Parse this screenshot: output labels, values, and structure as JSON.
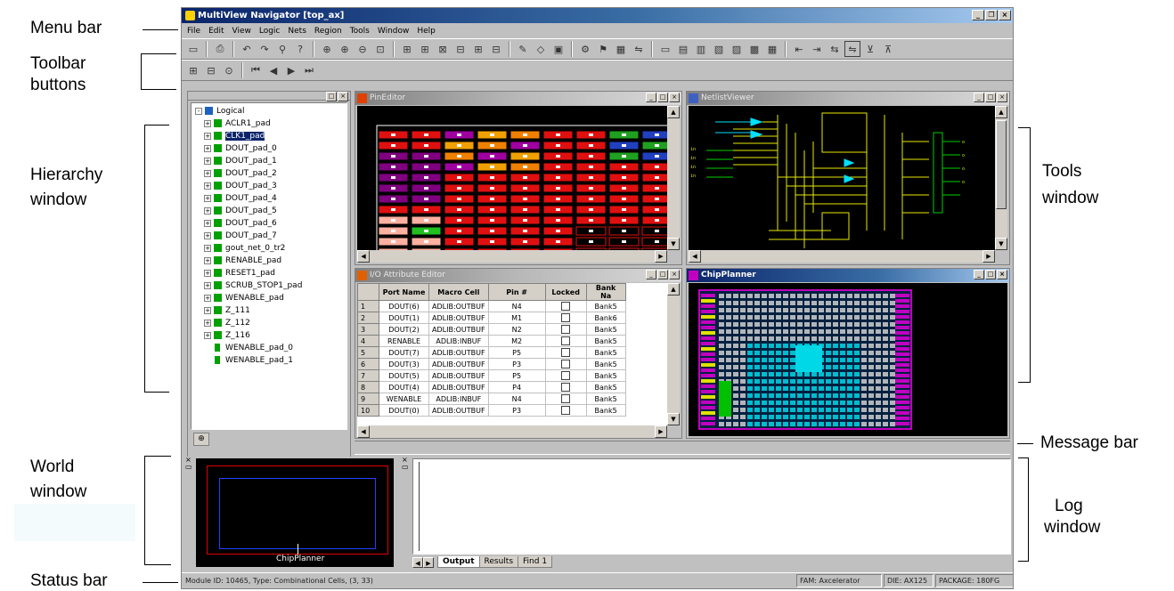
{
  "callouts": {
    "menu_bar": "Menu bar",
    "toolbar_buttons_1": "Toolbar",
    "toolbar_buttons_2": "buttons",
    "hierarchy_window_1": "Hierarchy",
    "hierarchy_window_2": "window",
    "tools_window_1": "Tools",
    "tools_window_2": "window",
    "message_bar": "Message bar",
    "world_window_1": "World",
    "world_window_2": "window",
    "log_window_1": "Log",
    "log_window_2": "window",
    "status_bar": "Status bar"
  },
  "app": {
    "title": "MultiView Navigator [top_ax]",
    "menu": [
      "File",
      "Edit",
      "View",
      "Logic",
      "Nets",
      "Region",
      "Tools",
      "Window",
      "Help"
    ]
  },
  "hierarchy": {
    "root": "Logical",
    "items": [
      {
        "label": "ACLR1_pad",
        "expand": "+",
        "selected": false
      },
      {
        "label": "CLK1_pad",
        "expand": "+",
        "selected": true
      },
      {
        "label": "DOUT_pad_0",
        "expand": "+",
        "selected": false
      },
      {
        "label": "DOUT_pad_1",
        "expand": "+",
        "selected": false
      },
      {
        "label": "DOUT_pad_2",
        "expand": "+",
        "selected": false
      },
      {
        "label": "DOUT_pad_3",
        "expand": "+",
        "selected": false
      },
      {
        "label": "DOUT_pad_4",
        "expand": "+",
        "selected": false
      },
      {
        "label": "DOUT_pad_5",
        "expand": "+",
        "selected": false
      },
      {
        "label": "DOUT_pad_6",
        "expand": "+",
        "selected": false
      },
      {
        "label": "DOUT_pad_7",
        "expand": "+",
        "selected": false
      },
      {
        "label": "gout_net_0_tr2",
        "expand": "+",
        "selected": false
      },
      {
        "label": "RENABLE_pad",
        "expand": "+",
        "selected": false
      },
      {
        "label": "RESET1_pad",
        "expand": "+",
        "selected": false
      },
      {
        "label": "SCRUB_STOP1_pad",
        "expand": "+",
        "selected": false
      },
      {
        "label": "WENABLE_pad",
        "expand": "+",
        "selected": false
      },
      {
        "label": "Z_111",
        "expand": "+",
        "selected": false
      },
      {
        "label": "Z_112",
        "expand": "+",
        "selected": false
      },
      {
        "label": "Z_116",
        "expand": "+",
        "selected": false
      },
      {
        "label": "WENABLE_pad_0",
        "expand": "",
        "selected": false
      },
      {
        "label": "WENABLE_pad_1",
        "expand": "",
        "selected": false
      }
    ]
  },
  "windows": {
    "pinedit": "PinEditor",
    "netlist": "NetlistViewer",
    "attr": "I/O Attribute Editor",
    "chip": "ChipPlanner"
  },
  "attr_table": {
    "headers": [
      "",
      "Port Name",
      "Macro Cell",
      "Pin #",
      "Locked",
      "Bank Na"
    ],
    "rows": [
      [
        "1",
        "DOUT(6)",
        "ADLIB:OUTBUF",
        "N4",
        "Bank5"
      ],
      [
        "2",
        "DOUT(1)",
        "ADLIB:OUTBUF",
        "M1",
        "Bank6"
      ],
      [
        "3",
        "DOUT(2)",
        "ADLIB:OUTBUF",
        "N2",
        "Bank5"
      ],
      [
        "4",
        "RENABLE",
        "ADLIB:INBUF",
        "M2",
        "Bank5"
      ],
      [
        "5",
        "DOUT(7)",
        "ADLIB:OUTBUF",
        "P5",
        "Bank5"
      ],
      [
        "6",
        "DOUT(3)",
        "ADLIB:OUTBUF",
        "P3",
        "Bank5"
      ],
      [
        "7",
        "DOUT(5)",
        "ADLIB:OUTBUF",
        "P5",
        "Bank5"
      ],
      [
        "8",
        "DOUT(4)",
        "ADLIB:OUTBUF",
        "P4",
        "Bank5"
      ],
      [
        "9",
        "WENABLE",
        "ADLIB:INBUF",
        "N4",
        "Bank5"
      ],
      [
        "10",
        "DOUT(0)",
        "ADLIB:OUTBUF",
        "P3",
        "Bank5"
      ]
    ]
  },
  "world": {
    "label": "ChipPlanner"
  },
  "log": {
    "tabs": [
      "Output",
      "Results",
      "Find 1"
    ]
  },
  "status": {
    "left": "Module ID: 10465, Type: Combinational Cells, (3, 33)",
    "field1": "FAM: Axcelerator",
    "field2": "DIE: AX125",
    "field3": "PACKAGE: 180FG"
  },
  "colors": {
    "title_active": "#0a246a",
    "chip_bg": "#000000",
    "pin_red": "#e01010",
    "chip_cyan": "#00d8e8"
  }
}
